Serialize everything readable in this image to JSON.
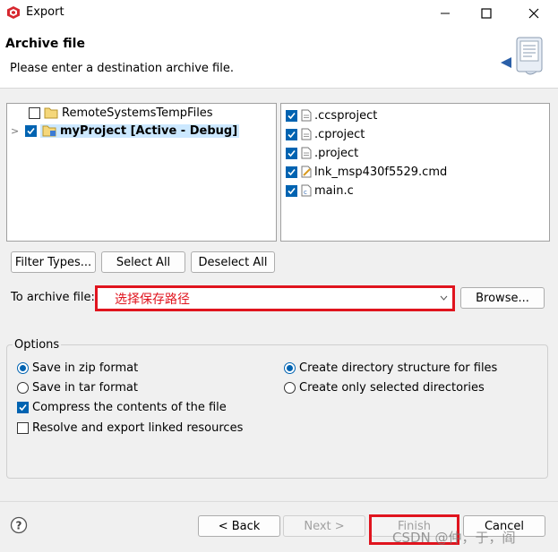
{
  "window": {
    "title": "Export"
  },
  "header": {
    "title": "Archive file",
    "subtitle": "Please enter a destination archive file."
  },
  "projects": [
    {
      "label": "RemoteSystemsTempFiles",
      "checked": false,
      "bold": false
    },
    {
      "label": "myProject  [Active - Debug]",
      "checked": true,
      "bold": true
    }
  ],
  "files": [
    {
      "label": ".ccsproject",
      "checked": true
    },
    {
      "label": ".cproject",
      "checked": true
    },
    {
      "label": ".project",
      "checked": true
    },
    {
      "label": "lnk_msp430f5529.cmd",
      "checked": true
    },
    {
      "label": "main.c",
      "checked": true
    }
  ],
  "buttons": {
    "filter_types": "Filter Types...",
    "select_all": "Select All",
    "deselect_all": "Deselect All",
    "browse": "Browse...",
    "back": "< Back",
    "next": "Next >",
    "finish": "Finish",
    "cancel": "Cancel"
  },
  "archive": {
    "label": "To archive file:",
    "value": "",
    "annotation": "选择保存路径"
  },
  "options": {
    "title": "Options",
    "zip": "Save in zip format",
    "tar": "Save in tar format",
    "compress": "Compress the contents of the file",
    "resolve": "Resolve and export linked resources",
    "create_structure": "Create directory structure for files",
    "create_selected": "Create only selected directories"
  },
  "watermark": "CSDN @仲，于，阎",
  "colors": {
    "accent": "#0063b1",
    "annotation": "#e0141e"
  }
}
